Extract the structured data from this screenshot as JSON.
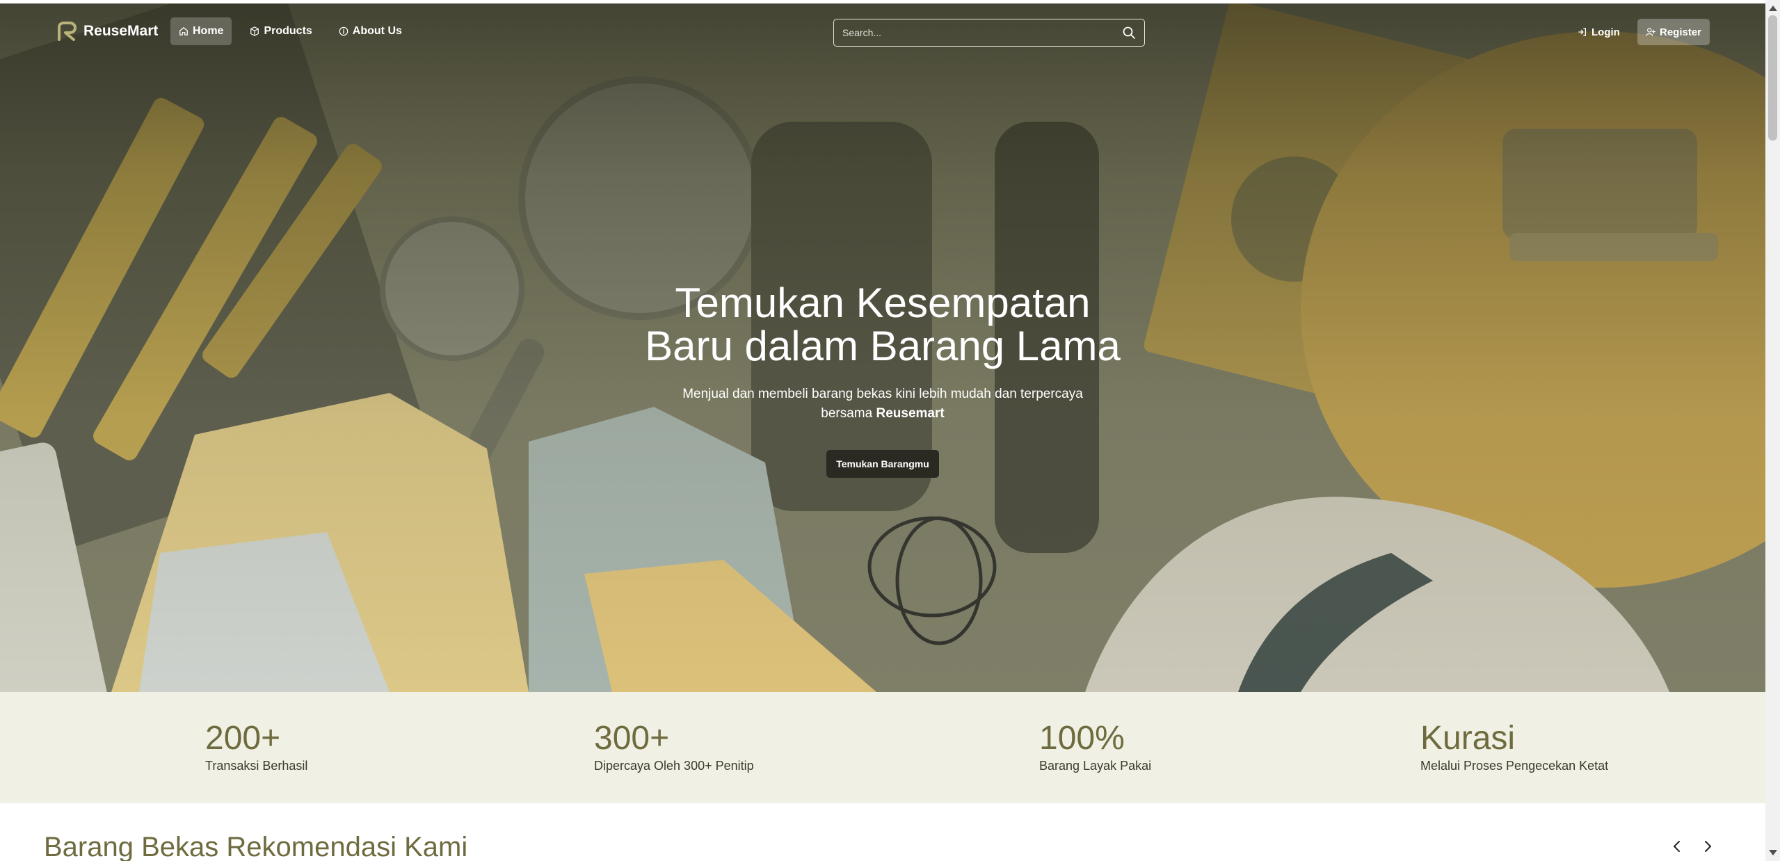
{
  "brand": {
    "name": "ReuseMart"
  },
  "nav": {
    "items": [
      {
        "label": "Home",
        "icon": "home-icon",
        "active": true
      },
      {
        "label": "Products",
        "icon": "box-icon",
        "active": false
      },
      {
        "label": "About Us",
        "icon": "info-icon",
        "active": false
      }
    ]
  },
  "search": {
    "placeholder": "Search..."
  },
  "auth": {
    "login_label": "Login",
    "register_label": "Register"
  },
  "hero": {
    "title_line1": "Temukan Kesempatan",
    "title_line2": "Baru dalam Barang Lama",
    "subtitle_line1": "Menjual dan membeli barang bekas kini lebih mudah dan terpercaya",
    "subtitle_line2_prefix": "bersama ",
    "subtitle_brand": "Reusemart",
    "cta_label": "Temukan Barangmu"
  },
  "stats": [
    {
      "value": "200+",
      "label": "Transaksi Berhasil"
    },
    {
      "value": "300+",
      "label": "Dipercaya Oleh 300+ Penitip"
    },
    {
      "value": "100%",
      "label": "Barang Layak Pakai"
    },
    {
      "value": "Kurasi",
      "label": "Melalui Proses Pengecekan Ketat"
    }
  ],
  "recommend": {
    "title": "Barang Bekas Rekomendasi Kami"
  },
  "colors": {
    "accent": "#6e6b3f",
    "stats_bg": "#f1f0e5",
    "cta_bg": "#2b2a22"
  }
}
